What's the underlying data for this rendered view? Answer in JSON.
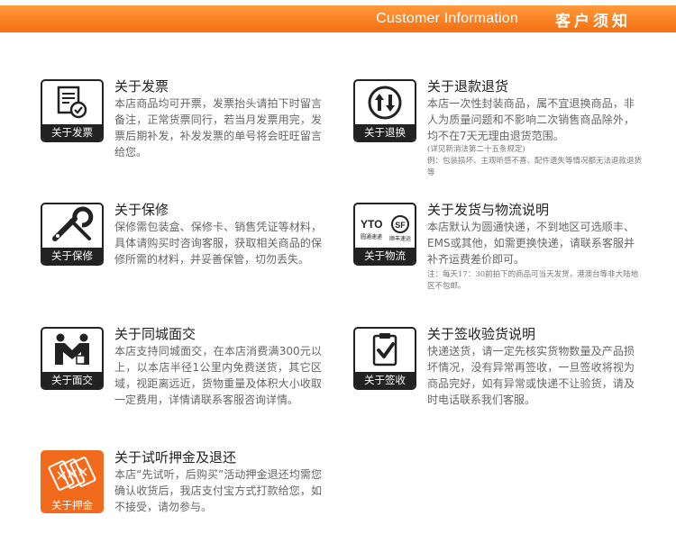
{
  "header": {
    "title_en": "Customer Information",
    "title_zh": "客户须知"
  },
  "sections": {
    "invoice": {
      "icon": "invoice-check-icon",
      "caption": "关于发票",
      "title": "关于发票",
      "text": "本店商品均可开票，发票抬头请拍下时留言备注，正常货票同行，若当月发票用完，发票后期补发，补发发票的单号将会旺旺留言给您。"
    },
    "refund": {
      "icon": "return-arrows-icon",
      "caption": "关于退换",
      "title": "关于退款退货",
      "text": "本店一次性封装商品，属不宜退换商品，非人为质量问题和不影响二次销售商品除外，均不在7天无理由退货范围。",
      "note1": "(详见新消法第二十五条规定)",
      "note2": "例：包装损坏、主观听感不喜、配件遗失等情况都无法退款退货等"
    },
    "warranty": {
      "icon": "wrench-icon",
      "caption": "关于保修",
      "title": "关于保修",
      "text": "保修需包装盒、保修卡、销售凭证等材料，具体请购买时咨询客服，获取相关商品的保修所需的材料，并妥善保管，切勿丢失。"
    },
    "shipping": {
      "icon": "courier-logos-icon",
      "caption": "关于物流",
      "logo_yto": "YTO",
      "logo_yto_name": "圆通速递",
      "logo_sf": "SF",
      "logo_sf_name": "顺丰速运",
      "title": "关于发货与物流说明",
      "text": "本店默认为圆通快递，不到地区可选顺丰、EMS或其他，如需更换快递，请联系客服并补齐运费差价即可。",
      "note": "注：每天17：30前拍下的商品可当天发货，港澳台等非大陆地区不包邮。"
    },
    "local": {
      "icon": "handshake-icon",
      "caption": "关于面交",
      "title": "关于同城面交",
      "text": "本店支持同城面交，在本店消费满300元以上，以本店半径1公里内免费送货，其它区域，视距离远近，货物重量及体积大小收取一定费用，详情请联系客服咨询详情。"
    },
    "receipt": {
      "icon": "clipboard-check-icon",
      "caption": "关于签收",
      "title": "关于签收验货说明",
      "text": "快递送货，请一定先核实货物数量及产品损坏情况，没有异常再签收，一旦签收将视为商品完好，如有异常或快递不让验货，请及时电话联系我们客服。"
    },
    "deposit": {
      "icon": "tickets-icon",
      "caption": "关于押金",
      "title": "关于试听押金及退还",
      "text": "本店“先试听，后购买”活动押金退还均需您确认收货后，我店支付宝方式打款给您，如不接受，请勿参与。"
    }
  },
  "colors": {
    "accent": "#f46f12",
    "dark": "#222222"
  }
}
